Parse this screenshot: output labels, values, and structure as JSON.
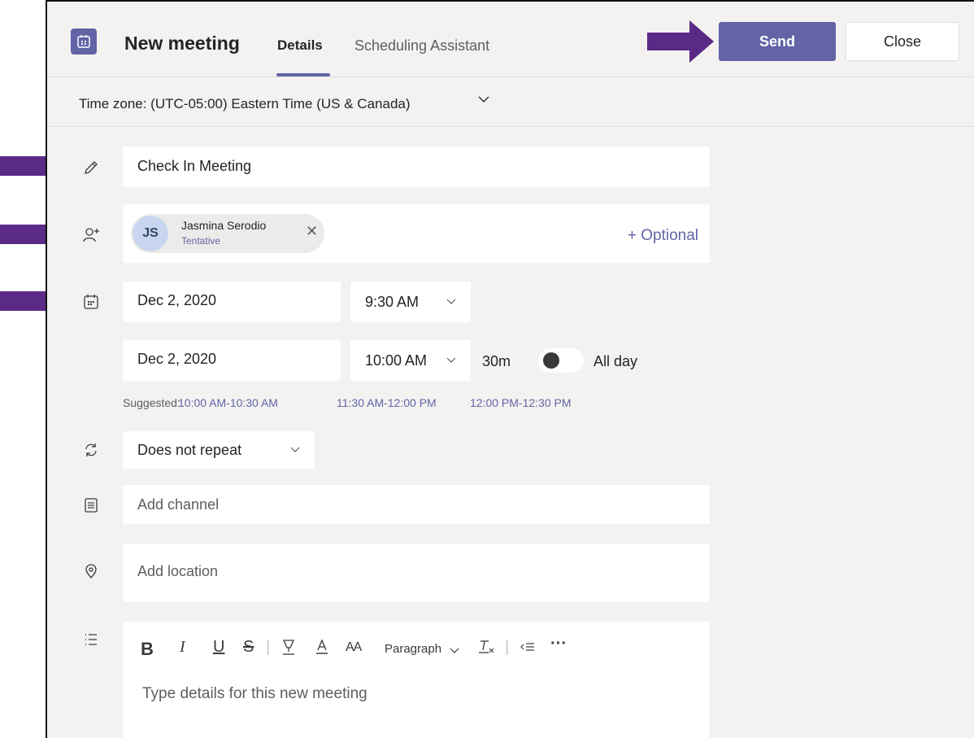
{
  "header": {
    "title": "New meeting",
    "tabs": [
      {
        "label": "Details",
        "active": true
      },
      {
        "label": "Scheduling Assistant",
        "active": false
      }
    ],
    "send_label": "Send",
    "close_label": "Close"
  },
  "timezone": {
    "label": "Time zone: (UTC-05:00) Eastern Time (US & Canada)"
  },
  "title_field": {
    "value": "Check In Meeting"
  },
  "attendees": {
    "items": [
      {
        "initials": "JS",
        "name": "Jasmina Serodio",
        "status": "Tentative"
      }
    ],
    "optional_label": "+ Optional"
  },
  "start": {
    "date": "Dec 2, 2020",
    "time": "9:30 AM"
  },
  "end": {
    "date": "Dec 2, 2020",
    "time": "10:00 AM",
    "duration": "30m"
  },
  "all_day": {
    "label": "All day",
    "on": false
  },
  "suggested": {
    "label": "Suggested:",
    "slots": [
      "10:00 AM-10:30 AM",
      "11:30 AM-12:00 PM",
      "12:00 PM-12:30 PM"
    ]
  },
  "repeat": {
    "value": "Does not repeat"
  },
  "channel": {
    "placeholder": "Add channel"
  },
  "location": {
    "placeholder": "Add location"
  },
  "editor": {
    "toolbar": {
      "bold": "B",
      "italic": "I",
      "underline": "U",
      "strike": "S",
      "font_size": "AA",
      "paragraph": "Paragraph"
    },
    "placeholder": "Type details for this new meeting"
  },
  "colors": {
    "brand": "#6264a7",
    "arrow": "#5b2a86",
    "background": "#f3f2f1"
  }
}
